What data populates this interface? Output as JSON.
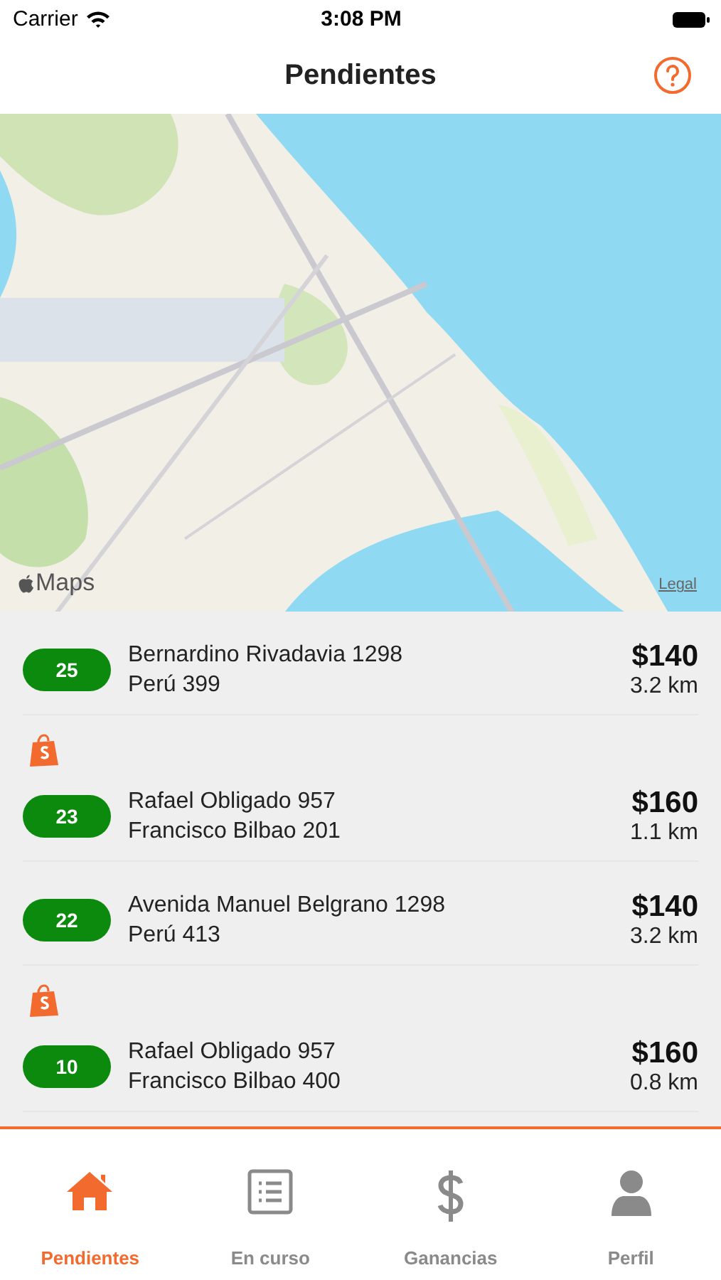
{
  "status_bar": {
    "carrier": "Carrier",
    "time": "3:08 PM"
  },
  "nav_bar": {
    "title": "Pendientes"
  },
  "map": {
    "kind": "picture",
    "attribution": "Maps",
    "legal_link": "Legal"
  },
  "orders": [
    {
      "number": "25",
      "pickup": "Bernardino Rivadavia 1298",
      "dropoff": "Perú 399",
      "price": "$140",
      "distance": "3.2 km",
      "shop_badge": false
    },
    {
      "number": "23",
      "pickup": "Rafael Obligado 957",
      "dropoff": "Francisco Bilbao 201",
      "price": "$160",
      "distance": "1.1 km",
      "shop_badge": true
    },
    {
      "number": "22",
      "pickup": "Avenida Manuel Belgrano 1298",
      "dropoff": "Perú 413",
      "price": "$140",
      "distance": "3.2 km",
      "shop_badge": false
    },
    {
      "number": "10",
      "pickup": "Rafael Obligado 957",
      "dropoff": "Francisco Bilbao 400",
      "price": "$160",
      "distance": "0.8 km",
      "shop_badge": true
    }
  ],
  "tab_bar": [
    {
      "kind": "home",
      "label": "Pendientes",
      "selected": true
    },
    {
      "kind": "list",
      "label": "En curso",
      "selected": false
    },
    {
      "kind": "dollar",
      "label": "Ganancias",
      "selected": false
    },
    {
      "kind": "person",
      "label": "Perfil",
      "selected": false
    }
  ]
}
